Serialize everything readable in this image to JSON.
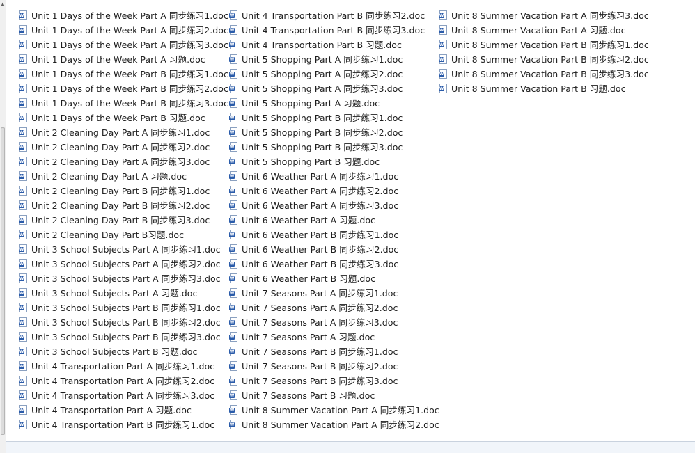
{
  "file_icon": "word-doc-icon",
  "columns": [
    {
      "files": [
        "Unit 1 Days of the Week Part A 同步练习1.doc",
        "Unit 1 Days of the Week Part A 同步练习2.doc",
        "Unit 1 Days of the Week Part A 同步练习3.doc",
        "Unit 1 Days of the Week Part A 习题.doc",
        "Unit 1 Days of the Week Part B 同步练习1.doc",
        "Unit 1 Days of the Week Part B 同步练习2.doc",
        "Unit 1 Days of the Week Part B 同步练习3.doc",
        "Unit 1 Days of the Week Part B 习题.doc",
        "Unit 2 Cleaning Day Part A 同步练习1.doc",
        "Unit 2 Cleaning Day Part A 同步练习2.doc",
        "Unit 2 Cleaning Day Part A 同步练习3.doc",
        "Unit 2 Cleaning Day Part A 习题.doc",
        "Unit 2 Cleaning Day Part B 同步练习1.doc",
        "Unit 2 Cleaning Day Part B 同步练习2.doc",
        "Unit 2 Cleaning Day Part B 同步练习3.doc",
        "Unit 2 Cleaning Day Part B习题.doc",
        "Unit 3 School Subjects Part A 同步练习1.doc",
        "Unit 3 School Subjects Part A 同步练习2.doc",
        "Unit 3 School Subjects Part A 同步练习3.doc",
        "Unit 3 School Subjects Part A 习题.doc",
        "Unit 3 School Subjects Part B 同步练习1.doc",
        "Unit 3 School Subjects Part B 同步练习2.doc",
        "Unit 3 School Subjects Part B 同步练习3.doc",
        "Unit 3 School Subjects Part B 习题.doc",
        "Unit 4 Transportation Part A 同步练习1.doc",
        "Unit 4 Transportation Part A 同步练习2.doc",
        "Unit 4 Transportation Part A 同步练习3.doc",
        "Unit 4 Transportation Part A 习题.doc",
        "Unit 4 Transportation Part B 同步练习1.doc"
      ]
    },
    {
      "files": [
        "Unit 4 Transportation Part B 同步练习2.doc",
        "Unit 4 Transportation Part B 同步练习3.doc",
        "Unit 4 Transportation Part B 习题.doc",
        "Unit 5 Shopping Part A 同步练习1.doc",
        "Unit 5 Shopping Part A 同步练习2.doc",
        "Unit 5 Shopping Part A 同步练习3.doc",
        "Unit 5 Shopping Part A 习题.doc",
        "Unit 5 Shopping Part B 同步练习1.doc",
        "Unit 5 Shopping Part B 同步练习2.doc",
        "Unit 5 Shopping Part B 同步练习3.doc",
        "Unit 5 Shopping Part B 习题.doc",
        "Unit 6 Weather Part A 同步练习1.doc",
        "Unit 6 Weather Part A 同步练习2.doc",
        "Unit 6 Weather Part A 同步练习3.doc",
        "Unit 6 Weather Part A 习题.doc",
        "Unit 6 Weather Part B 同步练习1.doc",
        "Unit 6 Weather Part B 同步练习2.doc",
        "Unit 6 Weather Part B 同步练习3.doc",
        "Unit 6 Weather Part B 习题.doc",
        "Unit 7 Seasons Part A 同步练习1.doc",
        "Unit 7 Seasons Part A 同步练习2.doc",
        "Unit 7 Seasons Part A 同步练习3.doc",
        "Unit 7 Seasons Part A 习题.doc",
        "Unit 7 Seasons Part B 同步练习1.doc",
        "Unit 7 Seasons Part B 同步练习2.doc",
        "Unit 7 Seasons Part B 同步练习3.doc",
        "Unit 7 Seasons Part B 习题.doc",
        "Unit 8 Summer Vacation Part A 同步练习1.doc",
        "Unit 8 Summer Vacation Part A 同步练习2.doc"
      ]
    },
    {
      "files": [
        "Unit 8 Summer Vacation Part A 同步练习3.doc",
        "Unit 8 Summer Vacation Part A 习题.doc",
        "Unit 8 Summer Vacation Part B 同步练习1.doc",
        "Unit 8 Summer Vacation Part B 同步练习2.doc",
        "Unit 8 Summer Vacation Part B 同步练习3.doc",
        "Unit 8 Summer Vacation Part B 习题.doc"
      ]
    }
  ]
}
